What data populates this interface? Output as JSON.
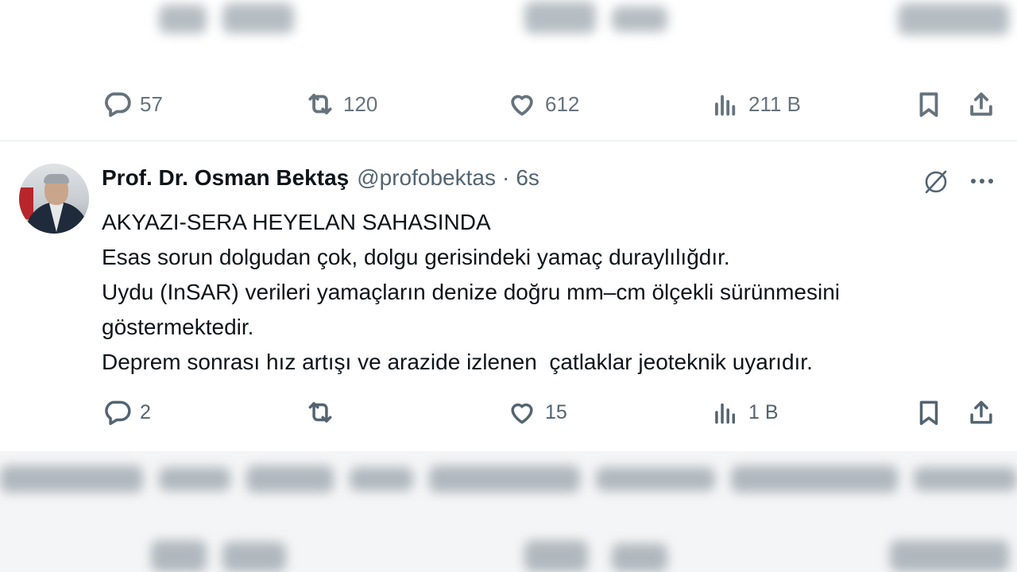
{
  "previous_tweet": {
    "replies": "57",
    "reposts": "120",
    "likes": "612",
    "views": "211 B"
  },
  "tweet": {
    "author_name": "Prof. Dr. Osman Bektaş",
    "handle": "@profobektas",
    "separator": "·",
    "time": "6s",
    "lines": [
      "AKYAZI-SERA HEYELAN SAHASINDA",
      "Esas sorun dolgudan çok, dolgu gerisindeki yamaç duraylılığdır.",
      "Uydu (InSAR) verileri yamaçların denize doğru mm–cm ölçekli sürünmesini",
      "göstermektedir.",
      "Deprem sonrası hız artışı ve arazide izlenen  çatlaklar jeoteknik uyarıdır."
    ],
    "replies": "2",
    "reposts": "",
    "likes": "15",
    "views": "1 B"
  },
  "icons": {
    "reply": "reply-icon",
    "repost": "repost-icon",
    "like": "heart-icon",
    "views": "views-icon",
    "bookmark": "bookmark-icon",
    "share": "share-icon",
    "grok": "grok-icon",
    "more": "more-icon"
  },
  "colors": {
    "text_primary": "#0f1419",
    "text_secondary": "#536471",
    "divider": "#eff3f4"
  }
}
